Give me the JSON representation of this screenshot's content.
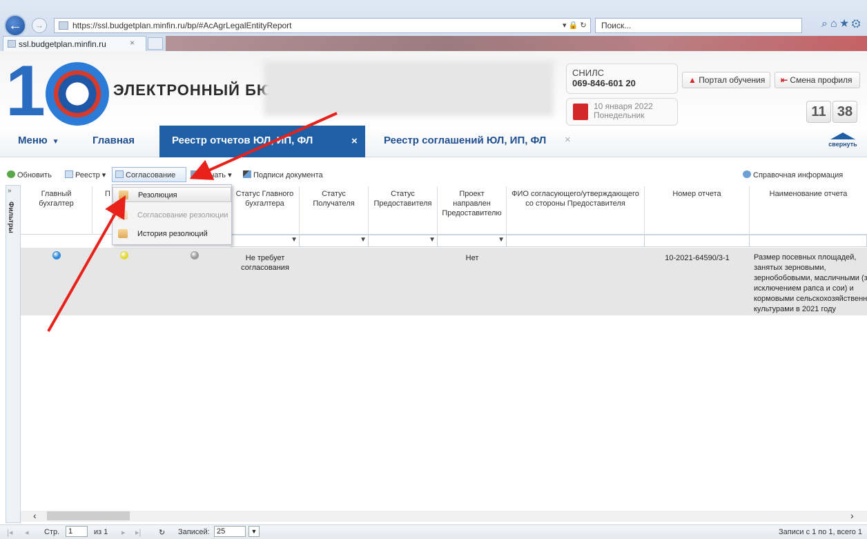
{
  "browser": {
    "url": "https://ssl.budgetplan.minfin.ru/bp/#AcAgrLegalEntityReport",
    "search_placeholder": "Поиск...",
    "search_icon": "magnifier-icon",
    "tab_title": "ssl.budgetplan.minfin.ru",
    "tab_close": "×"
  },
  "header": {
    "logo_text": "ЭЛЕКТРОННЫЙ БЮ",
    "snils_label": "СНИЛС",
    "snils_value": "069-846-601 20",
    "date": "10 января 2022",
    "weekday": "Понедельник",
    "clock_hours": "11",
    "clock_minutes": "38",
    "portal_button": "Портал обучения",
    "profile_button": "Смена профиля"
  },
  "nav": {
    "menu": "Меню",
    "home": "Главная",
    "active_tab": "Реестр отчетов ЮЛ, ИП, ФЛ",
    "active_tab_close": "×",
    "tab2": "Реестр соглашений ЮЛ, ИП, ФЛ",
    "tab2_close": "×",
    "collapse": "свернуть"
  },
  "toolbar": {
    "refresh": "Обновить",
    "registry": "Реестр",
    "approval": "Согласование",
    "print": "Печать",
    "signatures": "Подписи документа",
    "help": "Справочная информация"
  },
  "filters_label": "Фильтры",
  "dropdown": {
    "items": [
      "Резолюция",
      "Согласование резолюции",
      "История резолюций"
    ]
  },
  "grid": {
    "headers": [
      "Главный бухгалтер",
      "П",
      "Статус Главного бухгалтера",
      "Статус Получателя",
      "Статус Предоставителя",
      "Проект направлен Предоставителю",
      "ФИО согласующего/утверждающего со стороны Предоставителя",
      "Номер отчета",
      "Наименование отчета"
    ],
    "row": {
      "chief_status": "Не требует согласования",
      "sent": "Нет",
      "report_number": "10-2021-64590/3-1",
      "report_name": [
        "Размер посевных площадей,",
        "занятых зерновыми,",
        "зернобобовыми, масличными (з",
        "исключением рапса и сои) и",
        "кормовыми сельскохозяйственн",
        "культурами в 2021 году"
      ],
      "status_colors": [
        "#2f8ad8",
        "#e4d93a",
        "#9a9a9a"
      ]
    }
  },
  "pager": {
    "page_label": "Стр.",
    "page_value": "1",
    "of_label": "из 1",
    "per_page_label": "Записей:",
    "per_page_value": "25",
    "records": "Записи с 1 по 1, всего 1"
  },
  "colors": {
    "accent": "#1f5fa6",
    "annotation_arrow": "#e8221b"
  }
}
